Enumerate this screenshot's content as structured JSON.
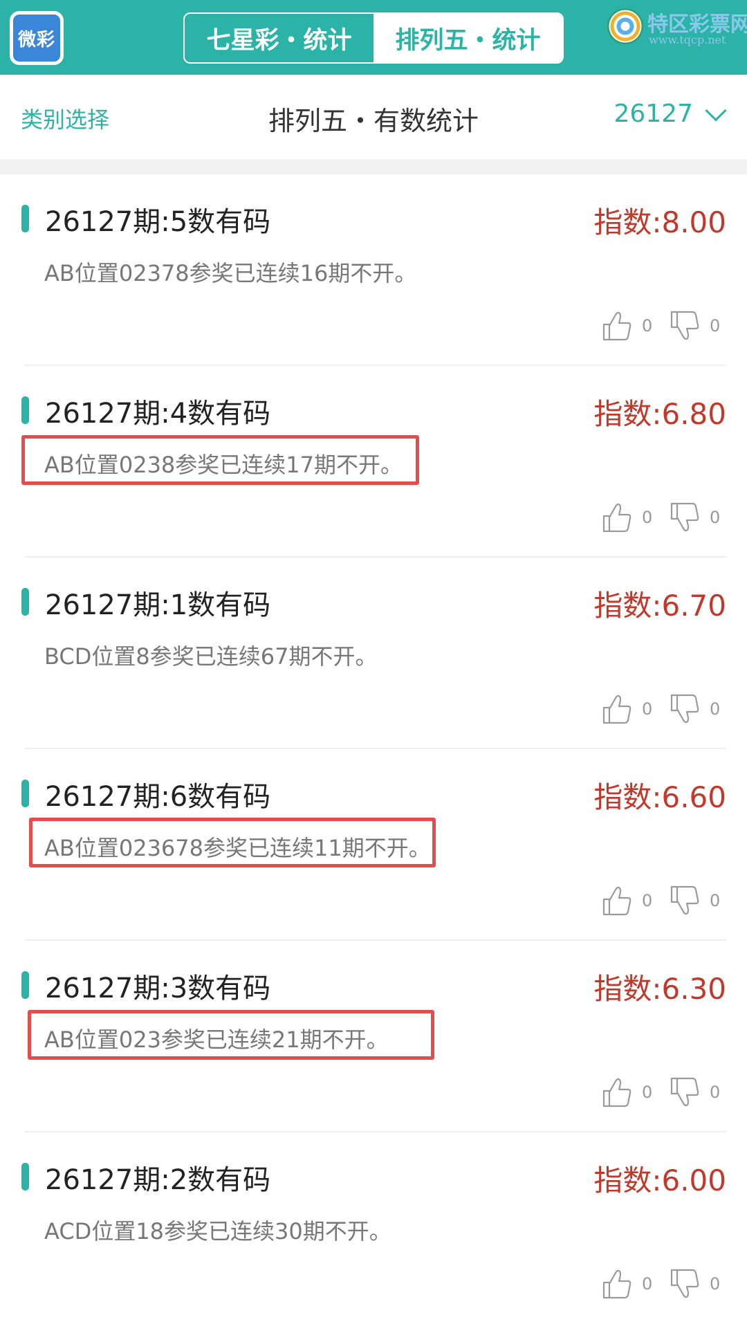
{
  "header": {
    "logo_text": "微彩",
    "tabs": [
      {
        "label": "七星彩・统计",
        "active": false
      },
      {
        "label": "排列五・统计",
        "active": true
      }
    ],
    "brand_name": "特区彩票网",
    "brand_url": "www.tqcp.net"
  },
  "filter": {
    "category_label": "类别选择",
    "title": "排列五・有数统计",
    "issue": "26127"
  },
  "items": [
    {
      "title": "26127期:5数有码",
      "score": "指数:8.00",
      "desc": "AB位置02378参奖已连续16期不开。",
      "likes": "0",
      "dislikes": "0",
      "highlighted": false
    },
    {
      "title": "26127期:4数有码",
      "score": "指数:6.80",
      "desc": "AB位置0238参奖已连续17期不开。",
      "likes": "0",
      "dislikes": "0",
      "highlighted": true
    },
    {
      "title": "26127期:1数有码",
      "score": "指数:6.70",
      "desc": "BCD位置8参奖已连续67期不开。",
      "likes": "0",
      "dislikes": "0",
      "highlighted": false
    },
    {
      "title": "26127期:6数有码",
      "score": "指数:6.60",
      "desc": "AB位置023678参奖已连续11期不开。",
      "likes": "0",
      "dislikes": "0",
      "highlighted": true
    },
    {
      "title": "26127期:3数有码",
      "score": "指数:6.30",
      "desc": "AB位置023参奖已连续21期不开。",
      "likes": "0",
      "dislikes": "0",
      "highlighted": true
    },
    {
      "title": "26127期:2数有码",
      "score": "指数:6.00",
      "desc": "ACD位置18参奖已连续30期不开。",
      "likes": "0",
      "dislikes": "0",
      "highlighted": false
    }
  ],
  "colors": {
    "accent": "#2bb3a7",
    "score": "#c0392b",
    "highlight_border": "#e74c4c"
  }
}
